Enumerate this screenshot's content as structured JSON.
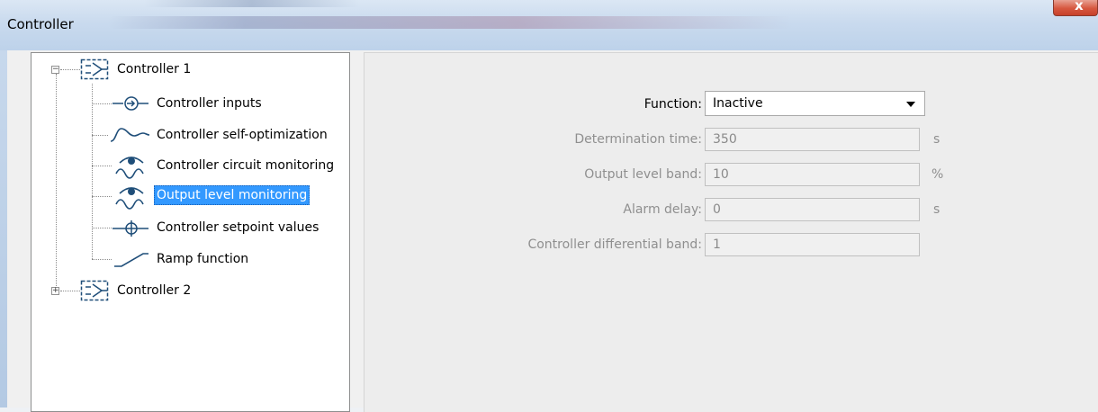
{
  "window": {
    "title": "Controller",
    "close_label": "x"
  },
  "tree": {
    "root1": {
      "label": "Controller 1",
      "expander": "−",
      "icon": "controller-block-icon",
      "children": [
        {
          "label": "Controller inputs",
          "icon": "input-arrow-circle-icon"
        },
        {
          "label": "Controller self-optimization",
          "icon": "step-wave-icon"
        },
        {
          "label": "Controller circuit monitoring",
          "icon": "eye-wave-icon"
        },
        {
          "label": "Output level monitoring",
          "icon": "eye-wave-icon",
          "selected": true
        },
        {
          "label": "Controller setpoint values",
          "icon": "crosshair-icon"
        },
        {
          "label": "Ramp function",
          "icon": "ramp-icon"
        }
      ]
    },
    "root2": {
      "label": "Controller 2",
      "expander": "+",
      "icon": "controller-block-icon"
    }
  },
  "form": {
    "function": {
      "label": "Function:",
      "value": "Inactive"
    },
    "determination_time": {
      "label": "Determination time:",
      "value": "350",
      "unit": "s"
    },
    "output_level_band": {
      "label": "Output level band:",
      "value": "10",
      "unit": "%"
    },
    "alarm_delay": {
      "label": "Alarm delay:",
      "value": "0",
      "unit": "s"
    },
    "controller_differential_band": {
      "label": "Controller differential band:",
      "value": "1"
    }
  },
  "colors": {
    "selection": "#3399ff",
    "icon_blue": "#1f4e79",
    "disabled_text": "#8f8f8f",
    "close_button": "#d6573f"
  }
}
